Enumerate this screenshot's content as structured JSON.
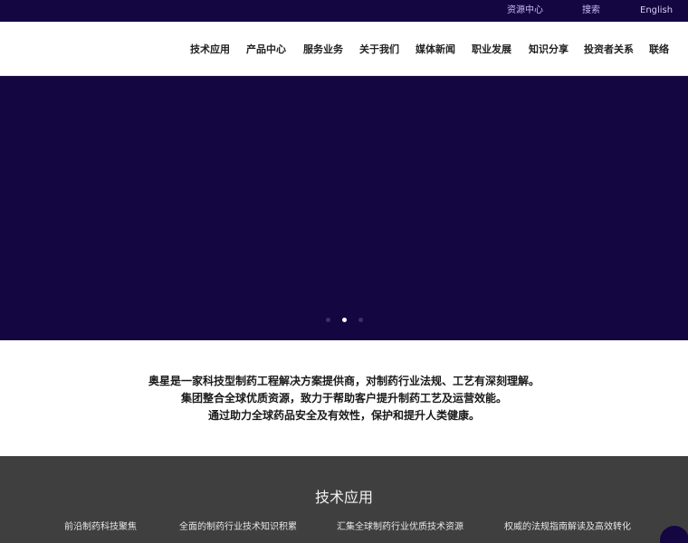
{
  "topbar": {
    "resource_center": "资源中心",
    "search": "搜索",
    "language": "English"
  },
  "nav": {
    "items": [
      {
        "label": "技术应用"
      },
      {
        "label": "产品中心"
      },
      {
        "label": "服务业务"
      },
      {
        "label": "关于我们"
      },
      {
        "label": "媒体新闻"
      },
      {
        "label": "职业发展"
      },
      {
        "label": "知识分享"
      },
      {
        "label": "投资者关系"
      },
      {
        "label": "联络"
      }
    ]
  },
  "hero": {
    "slide_count": 3,
    "active_slide": 2
  },
  "intro": {
    "line1": "奥星是一家科技型制药工程解决方案提供商，对制药行业法规、工艺有深刻理解。",
    "line2": "集团整合全球优质资源，致力于帮助客户提升制药工艺及运营效能。",
    "line3": "通过助力全球药品安全及有效性，保护和提升人类健康。"
  },
  "tech": {
    "title": "技术应用",
    "items": [
      {
        "label": "前沿制药科技聚焦"
      },
      {
        "label": "全面的制药行业技术知识积累"
      },
      {
        "label": "汇集全球制药行业优质技术资源"
      },
      {
        "label": "权威的法规指南解读及高效转化"
      }
    ]
  },
  "colors": {
    "brand_dark": "#140641",
    "section_gray": "#3f3f3f",
    "topbar_link": "#c9b8f2"
  }
}
